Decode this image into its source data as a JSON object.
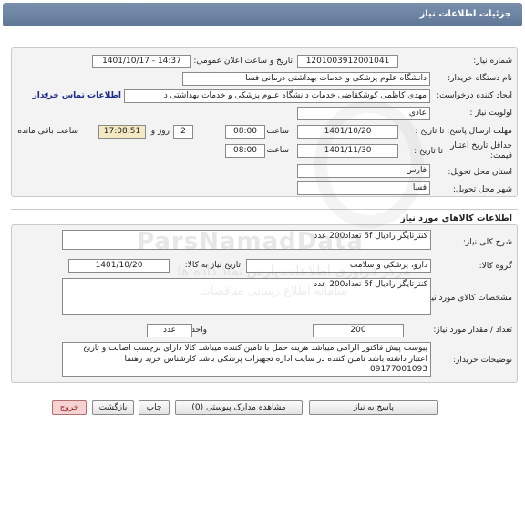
{
  "header": {
    "title": "جزئیات اطلاعات نیاز"
  },
  "info": {
    "need_number_label": "شماره نیاز:",
    "need_number": "1201003912001041",
    "announce_label": "تاریخ و ساعت اعلان عمومی:",
    "announce_value": "1401/10/17 - 14:37",
    "buyer_org_label": "نام دستگاه خریدار:",
    "buyer_org": "دانشگاه علوم پزشکی و خدمات بهداشتی درمانی فسا",
    "creator_label": "ایجاد کننده درخواست:",
    "creator": "مهدی  کاظمی کوشکقاضی خدمات دانشگاه علوم پزشکی و خدمات بهداشتی د",
    "contact_link": "اطلاعات تماس خریدار",
    "priority_label": "اولویت نیاز :",
    "priority": "عادی",
    "deadline_label": "مهلت ارسال پاسخ: تا تاریخ :",
    "deadline_date": "1401/10/20",
    "time_label": "ساعت",
    "deadline_time": "08:00",
    "days_value": "2",
    "days_label": "روز و",
    "remaining_time": "17:08:51",
    "remaining_label": "ساعت باقی مانده",
    "min_validity_label": "حداقل تاریخ اعتبار قیمت:",
    "until_date_label": "تا تاریخ :",
    "validity_date": "1401/11/30",
    "validity_time": "08:00",
    "province_label": "استان محل تحویل:",
    "province": "فارس",
    "city_label": "شهر محل تحویل:",
    "city": "فسا"
  },
  "goods": {
    "section_title": "اطلاعات کالاهای مورد نیاز",
    "summary_label": "شرح کلی نیاز:",
    "summary": "کنترتایگر  رادیال 5f تعداد200 عدد",
    "group_label": "گروه کالا:",
    "group": "دارو، پزشکی و سلامت",
    "need_date_label": "تاریخ نیاز به کالا:",
    "need_date": "1401/10/20",
    "spec_label": "مشخصات کالای مورد نیاز:",
    "spec": "کنترتایگر  رادیال 5f تعداد200 عدد",
    "qty_label": "تعداد / مقدار مورد نیاز:",
    "qty": "200",
    "unit_label": "واحد شمارش:",
    "unit": "عدد",
    "buyer_notes_label": "توضیحات خریدار:",
    "buyer_notes": "پیوست پیش فاکتور الزامی میباشد هزینه حمل با تامین کننده میباشد کالا دارای برچسب اصالت و تاریخ اعتبار داشته باشد تامین کننده در سایت اداره تجهیزات پزشکی باشد کارشناس خرید رهنما 09177001093"
  },
  "buttons": {
    "reply": "پاسخ به نیاز",
    "attachments": "مشاهده مدارک پیوستی (0)",
    "print": "چاپ",
    "back": "بازگشت",
    "exit": "خروج"
  },
  "watermark": {
    "brand": "ParsNamadData",
    "persian": "مرکز فراوری اطلاعات پارس نماد داده ها",
    "sub": "سامانه اطلاع رسانی مناقصات"
  },
  "colors": {
    "header": "#6b83a3",
    "highlight": "#f3e9c2",
    "panel": "#f3f3f3",
    "exit_button": "#f7d2d2"
  }
}
